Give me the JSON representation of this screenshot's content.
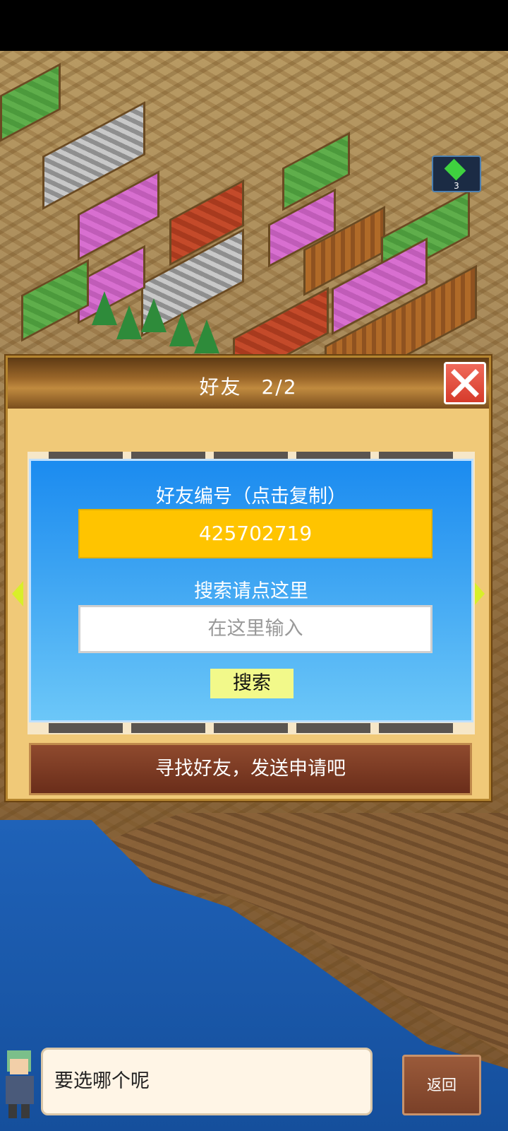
{
  "hud": {
    "gem_icon": "green-gem-icon",
    "gem_count": "3"
  },
  "dialog": {
    "title": "好友",
    "count": "2/2",
    "close_icon": "close-x-icon",
    "friend_id_label": "好友编号（点击复制）",
    "friend_id": "425702719",
    "search_label": "搜索请点这里",
    "search_placeholder": "在这里输入",
    "search_button": "搜索",
    "action_button": "寻找好友，发送申请吧",
    "nav_left_icon": "arrow-left-icon",
    "nav_right_icon": "arrow-right-icon"
  },
  "footer": {
    "speech_text": "要选哪个呢",
    "back_button": "返回"
  },
  "colors": {
    "panel_blue": "#1b8bf0",
    "id_yellow": "#ffc400",
    "close_red": "#d63b2b",
    "action_brown": "#6a2d1a"
  }
}
